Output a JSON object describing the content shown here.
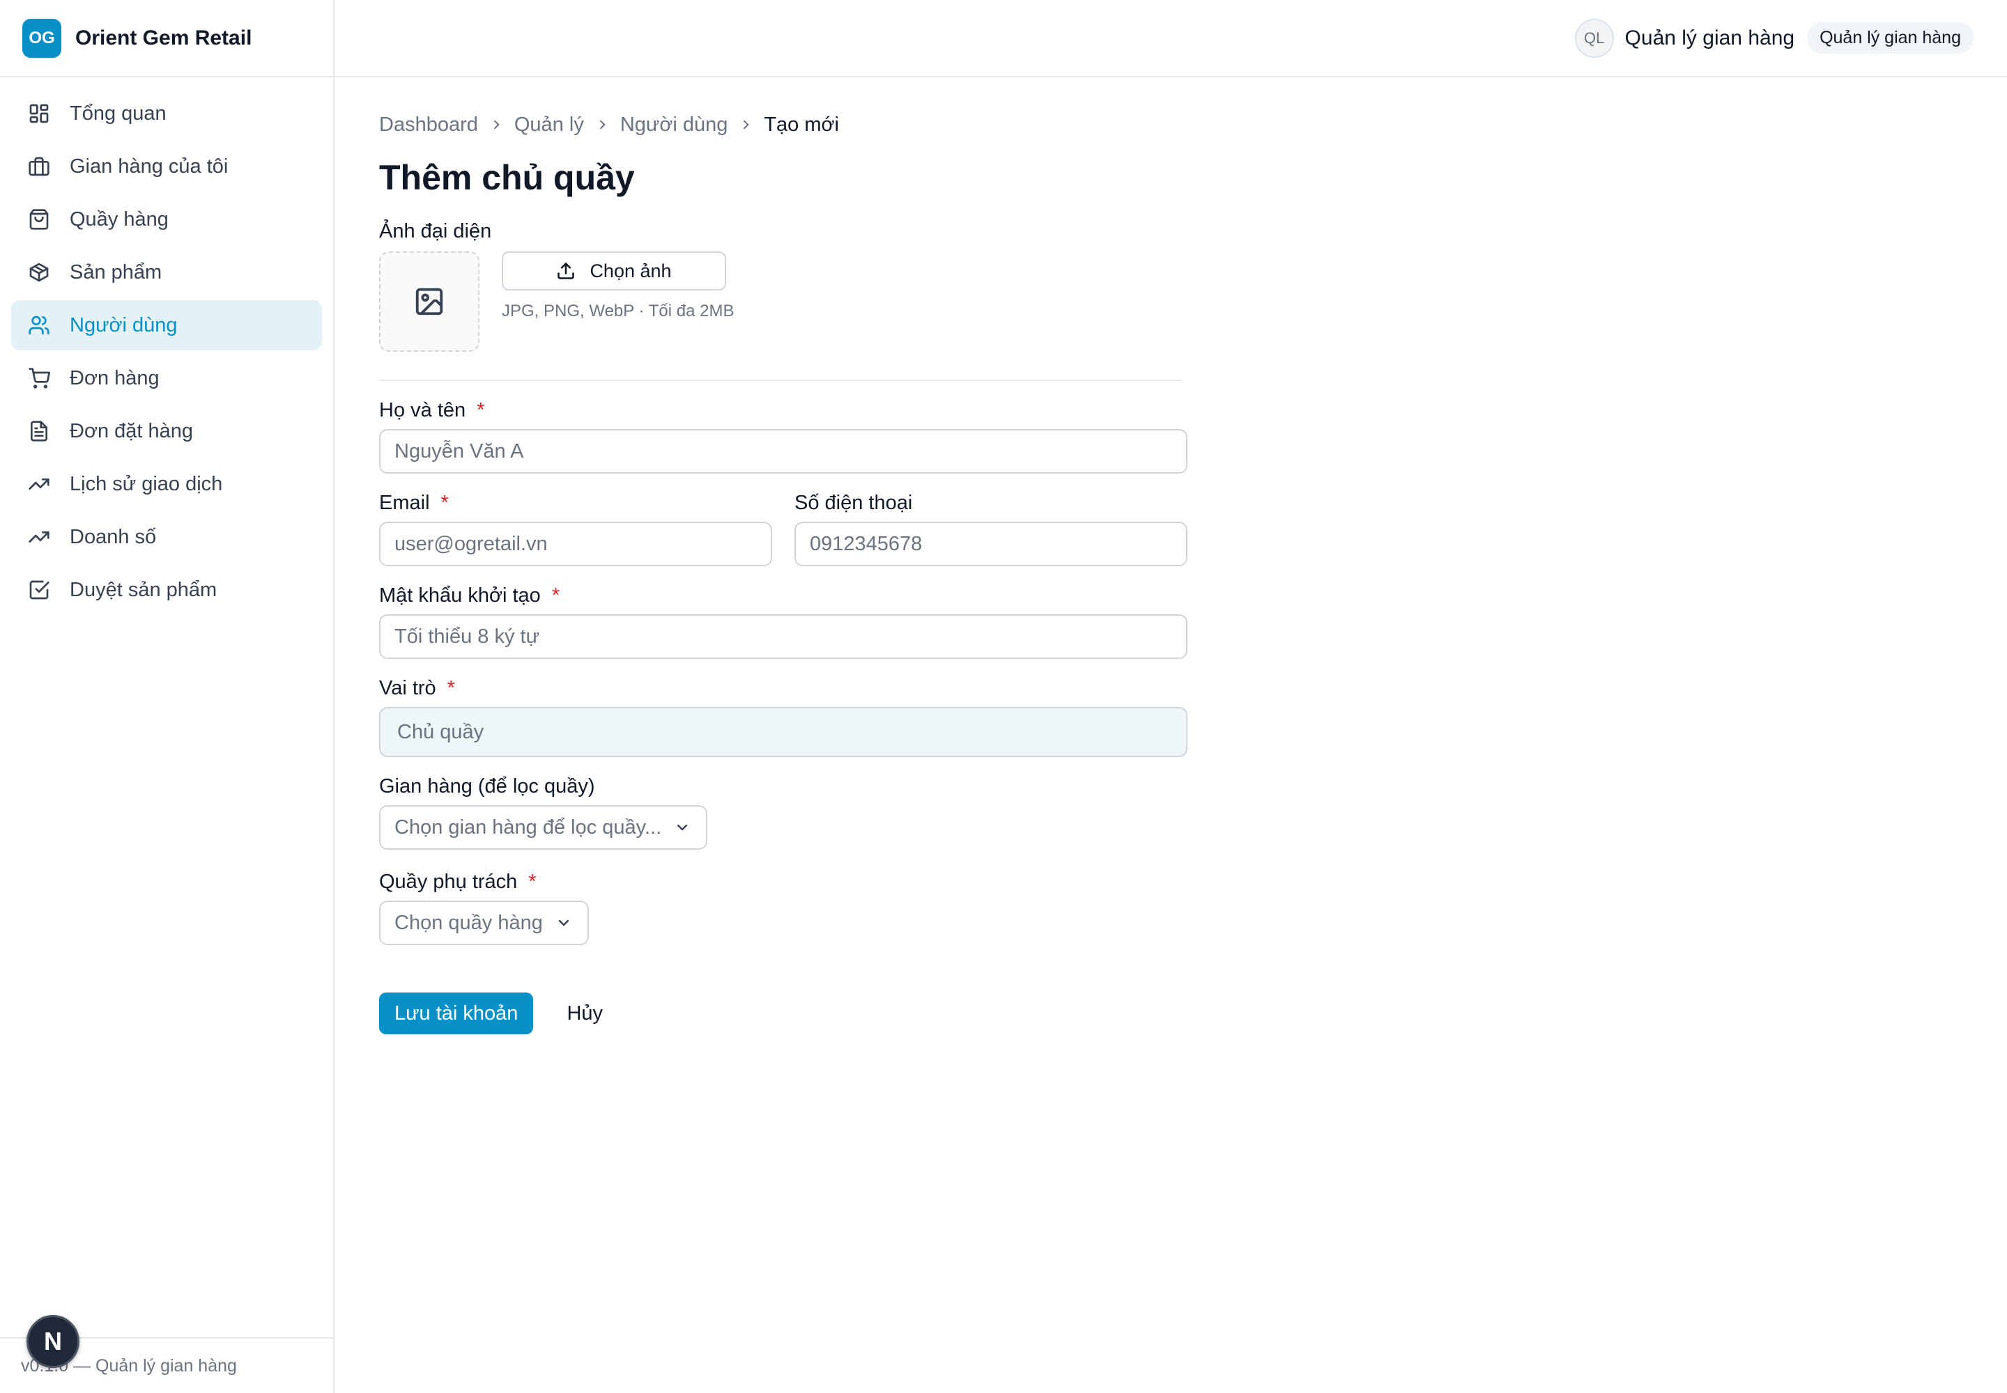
{
  "brand": {
    "logo_text": "OG",
    "name": "Orient Gem Retail"
  },
  "sidebar": {
    "items": [
      {
        "label": "Tổng quan",
        "icon": "dashboard-icon",
        "active": false
      },
      {
        "label": "Gian hàng của tôi",
        "icon": "briefcase-icon",
        "active": false
      },
      {
        "label": "Quầy hàng",
        "icon": "shopping-bag-icon",
        "active": false
      },
      {
        "label": "Sản phẩm",
        "icon": "package-icon",
        "active": false
      },
      {
        "label": "Người dùng",
        "icon": "users-icon",
        "active": true
      },
      {
        "label": "Đơn hàng",
        "icon": "cart-icon",
        "active": false
      },
      {
        "label": "Đơn đặt hàng",
        "icon": "file-text-icon",
        "active": false
      },
      {
        "label": "Lịch sử giao dịch",
        "icon": "trending-up-icon",
        "active": false
      },
      {
        "label": "Doanh số",
        "icon": "trending-up-icon",
        "active": false
      },
      {
        "label": "Duyệt sản phẩm",
        "icon": "check-square-icon",
        "active": false
      }
    ],
    "footer": "v0.1.0 — Quản lý gian hàng"
  },
  "dev_badge": "N",
  "header": {
    "avatar_initials": "QL",
    "user_name": "Quản lý gian hàng",
    "role": "Quản lý gian hàng"
  },
  "breadcrumb": [
    "Dashboard",
    "Quản lý",
    "Người dùng",
    "Tạo mới"
  ],
  "page_title": "Thêm chủ quầy",
  "form": {
    "avatar": {
      "label": "Ảnh đại diện",
      "button": "Chọn ảnh",
      "hint": "JPG, PNG, WebP · Tối đa 2MB"
    },
    "full_name": {
      "label": "Họ và tên",
      "required": "*",
      "placeholder": "Nguyễn Văn A"
    },
    "email": {
      "label": "Email",
      "required": "*",
      "placeholder": "user@ogretail.vn"
    },
    "phone": {
      "label": "Số điện thoại",
      "placeholder": "0912345678"
    },
    "password": {
      "label": "Mật khẩu khởi tạo",
      "required": "*",
      "placeholder": "Tối thiểu 8 ký tự"
    },
    "role": {
      "label": "Vai trò",
      "required": "*",
      "value": "Chủ quầy"
    },
    "store": {
      "label": "Gian hàng (để lọc quầy)",
      "placeholder": "Chọn gian hàng để lọc quầy..."
    },
    "counter": {
      "label": "Quầy phụ trách",
      "required": "*",
      "placeholder": "Chọn quầy hàng"
    },
    "save_label": "Lưu tài khoản",
    "cancel_label": "Hủy"
  },
  "colors": {
    "accent": "#0891c9",
    "active_bg": "#e4f2f8",
    "required": "#dc2626"
  }
}
